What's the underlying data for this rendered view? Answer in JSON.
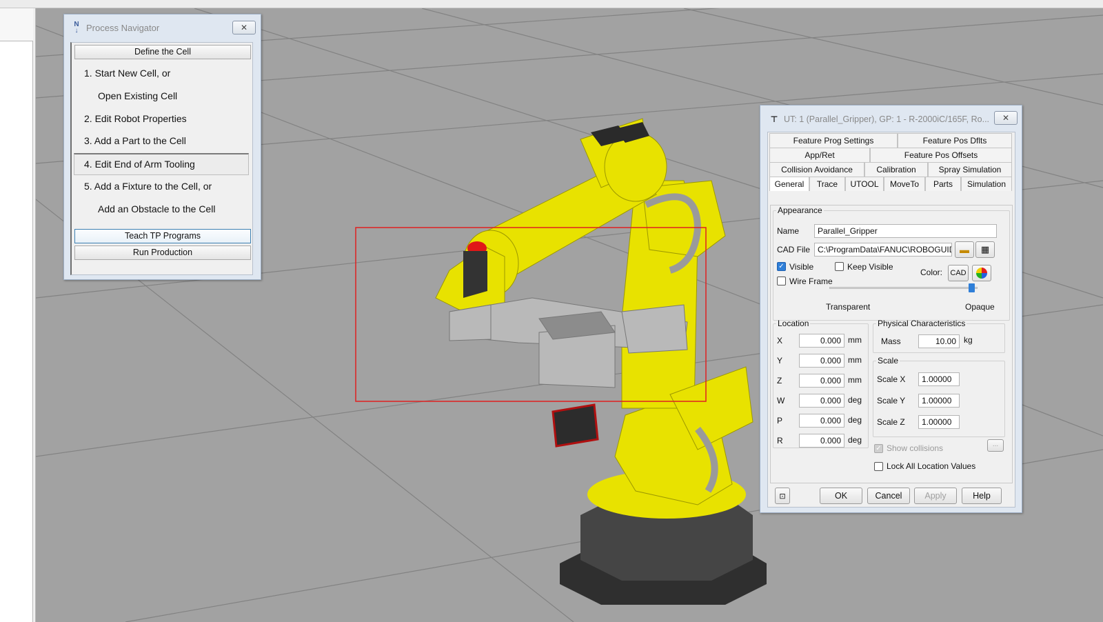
{
  "process_navigator": {
    "title": "Process Navigator",
    "title_icon": "N\n1",
    "close_icon": "close-icon",
    "define_cell": "Define the Cell",
    "steps": [
      "1.  Start New Cell, or",
      "Open Existing Cell",
      "2.  Edit Robot Properties",
      "3.  Add a Part to the Cell",
      "4.  Edit End of Arm Tooling",
      "5.  Add a Fixture to the Cell, or",
      "Add an Obstacle to the Cell"
    ],
    "teach_tp": "Teach TP Programs",
    "run_production": "Run Production"
  },
  "tool_dialog": {
    "title": "UT: 1  (Parallel_Gripper), GP: 1 - R-2000iC/165F, Ro...",
    "tabs_row1": [
      "Feature Prog Settings",
      "Feature Pos Dflts"
    ],
    "tabs_row2": [
      "App/Ret",
      "Feature Pos Offsets"
    ],
    "tabs_row3": [
      "Collision Avoidance",
      "Calibration",
      "Spray Simulation"
    ],
    "tabs_row4": [
      "General",
      "Trace",
      "UTOOL",
      "MoveTo",
      "Parts",
      "Simulation"
    ],
    "appearance": {
      "legend": "Appearance",
      "name_label": "Name",
      "name_value": "Parallel_Gripper",
      "cad_label": "CAD File",
      "cad_value": "C:\\ProgramData\\FANUC\\ROBOGUIDE\\",
      "visible": "Visible",
      "keep_visible": "Keep Visible",
      "wire_frame": "Wire Frame",
      "color_label": "Color:",
      "cad_btn": "CAD",
      "transparent": "Transparent",
      "opaque": "Opaque",
      "opacity_level": 0.96
    },
    "location": {
      "legend": "Location",
      "rows": [
        {
          "axis": "X",
          "value": "0.000",
          "unit": "mm"
        },
        {
          "axis": "Y",
          "value": "0.000",
          "unit": "mm"
        },
        {
          "axis": "Z",
          "value": "0.000",
          "unit": "mm"
        },
        {
          "axis": "W",
          "value": "0.000",
          "unit": "deg"
        },
        {
          "axis": "P",
          "value": "0.000",
          "unit": "deg"
        },
        {
          "axis": "R",
          "value": "0.000",
          "unit": "deg"
        }
      ]
    },
    "physical": {
      "legend": "Physical Characteristics",
      "mass_label": "Mass",
      "mass_value": "10.00",
      "mass_unit": "kg"
    },
    "scale": {
      "legend": "Scale",
      "rows": [
        {
          "label": "Scale X",
          "value": "1.00000"
        },
        {
          "label": "Scale Y",
          "value": "1.00000"
        },
        {
          "label": "Scale Z",
          "value": "1.00000"
        }
      ]
    },
    "show_collisions": "Show collisions",
    "ellipsis": "...",
    "lock_all": "Lock All Location Values",
    "buttons": {
      "ok": "OK",
      "cancel": "Cancel",
      "apply": "Apply",
      "help": "Help"
    }
  },
  "colors": {
    "robot_yellow": "#e8e200",
    "selection_box": "#e02020",
    "floor": "#a2a2a2",
    "accent_blue": "#2f7fd8"
  }
}
